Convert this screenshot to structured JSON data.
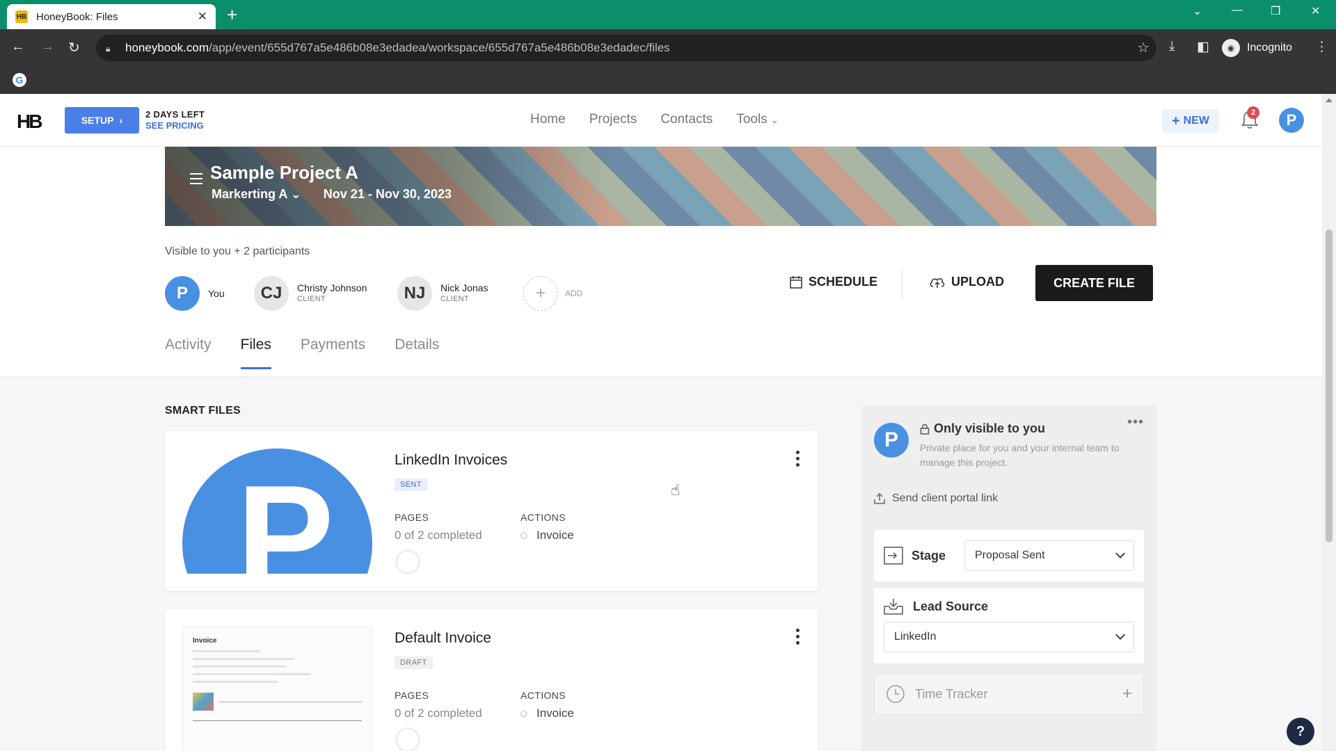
{
  "browser": {
    "tab_title": "HoneyBook: Files",
    "favicon_text": "HB",
    "url_host": "honeybook.com",
    "url_path": "/app/event/655d767a5e486b08e3edadea/workspace/655d767a5e486b08e3edadec/files",
    "profile_label": "Incognito",
    "google_letter": "G"
  },
  "header": {
    "logo": "HB",
    "setup_label": "SETUP",
    "days_left": "2 DAYS LEFT",
    "see_pricing": "SEE PRICING",
    "nav": [
      "Home",
      "Projects",
      "Contacts",
      "Tools"
    ],
    "new_label": "NEW",
    "notification_count": "2",
    "avatar_letter": "P"
  },
  "project": {
    "title": "Sample Project A",
    "company": "Markerting A",
    "dates": "Nov 21 - Nov 30, 2023",
    "visibility": "Visible to you + 2 participants",
    "participants": [
      {
        "initials": "P",
        "name": "You",
        "role": ""
      },
      {
        "initials": "CJ",
        "name": "Christy Johnson",
        "role": "CLIENT"
      },
      {
        "initials": "NJ",
        "name": "Nick Jonas",
        "role": "CLIENT"
      }
    ],
    "add_label": "ADD",
    "actions": {
      "schedule": "SCHEDULE",
      "upload": "UPLOAD",
      "create_file": "CREATE FILE"
    }
  },
  "tabs": [
    {
      "label": "Activity",
      "active": false
    },
    {
      "label": "Files",
      "active": true
    },
    {
      "label": "Payments",
      "active": false
    },
    {
      "label": "Details",
      "active": false
    }
  ],
  "smart_files": {
    "section_label": "SMART FILES",
    "files": [
      {
        "title": "LinkedIn Invoices",
        "status": "SENT",
        "pages_label": "PAGES",
        "pages_value": "0 of 2 completed",
        "actions_label": "ACTIONS",
        "action_item": "Invoice",
        "thumb_letter": "P"
      },
      {
        "title": "Default Invoice",
        "status": "DRAFT",
        "pages_label": "PAGES",
        "pages_value": "0 of 2 completed",
        "actions_label": "ACTIONS",
        "action_item": "Invoice",
        "thumb_title": "Invoice"
      }
    ]
  },
  "panel": {
    "avatar_letter": "P",
    "title": "Only visible to you",
    "description": "Private place for you and your internal team to manage this project.",
    "send_link": "Send client portal link",
    "stage_label": "Stage",
    "stage_value": "Proposal Sent",
    "lead_source_label": "Lead Source",
    "lead_source_value": "LinkedIn",
    "time_tracker_label": "Time Tracker"
  },
  "help_label": "?",
  "colors": {
    "brand_blue": "#4a90e2",
    "tab_green": "#0b8f6b",
    "accent": "#3b6fd8"
  }
}
